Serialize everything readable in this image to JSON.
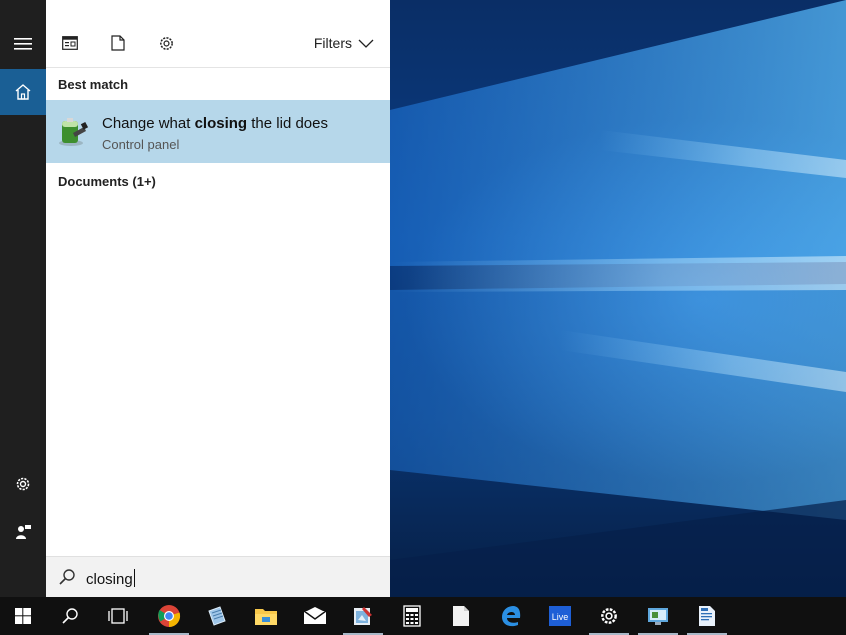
{
  "search": {
    "query": "closing",
    "filters_label": "Filters",
    "best_match_label": "Best match",
    "documents_label": "Documents (1+)"
  },
  "best_match": {
    "title_pre": "Change what ",
    "title_bold": "closing",
    "title_post": " the lid does",
    "subtitle": "Control panel",
    "icon": "battery-power-options-icon"
  },
  "rail": {
    "items": [
      {
        "icon": "hamburger-menu-icon"
      },
      {
        "icon": "home-icon",
        "active": true
      },
      {
        "icon": "settings-gear-icon"
      },
      {
        "icon": "feedback-person-icon"
      }
    ]
  },
  "header_tabs": [
    {
      "icon": "apps-window-icon"
    },
    {
      "icon": "documents-page-icon"
    },
    {
      "icon": "settings-gear-icon"
    }
  ],
  "taskbar": {
    "items": [
      {
        "icon": "windows-start-icon"
      },
      {
        "icon": "search-magnifier-icon"
      },
      {
        "icon": "task-view-icon"
      },
      {
        "icon": "chrome-icon",
        "running": true
      },
      {
        "icon": "notepad-pen-icon"
      },
      {
        "icon": "file-explorer-icon"
      },
      {
        "icon": "mail-icon"
      },
      {
        "icon": "paint-app-icon",
        "running": true
      },
      {
        "icon": "calculator-icon"
      },
      {
        "icon": "blank-document-icon"
      },
      {
        "icon": "edge-icon"
      },
      {
        "icon": "windows-live-icon"
      },
      {
        "icon": "settings-gear-icon",
        "running": true
      },
      {
        "icon": "control-panel-icon",
        "running": true
      },
      {
        "icon": "writer-document-icon",
        "running": true
      }
    ]
  },
  "colors": {
    "rail_bg": "#1f1f1f",
    "active_rail": "#1a5f95",
    "result_highlight": "#b6d7ea",
    "taskbar_bg": "#101010",
    "wallpaper_blue": "#0b3e86"
  }
}
